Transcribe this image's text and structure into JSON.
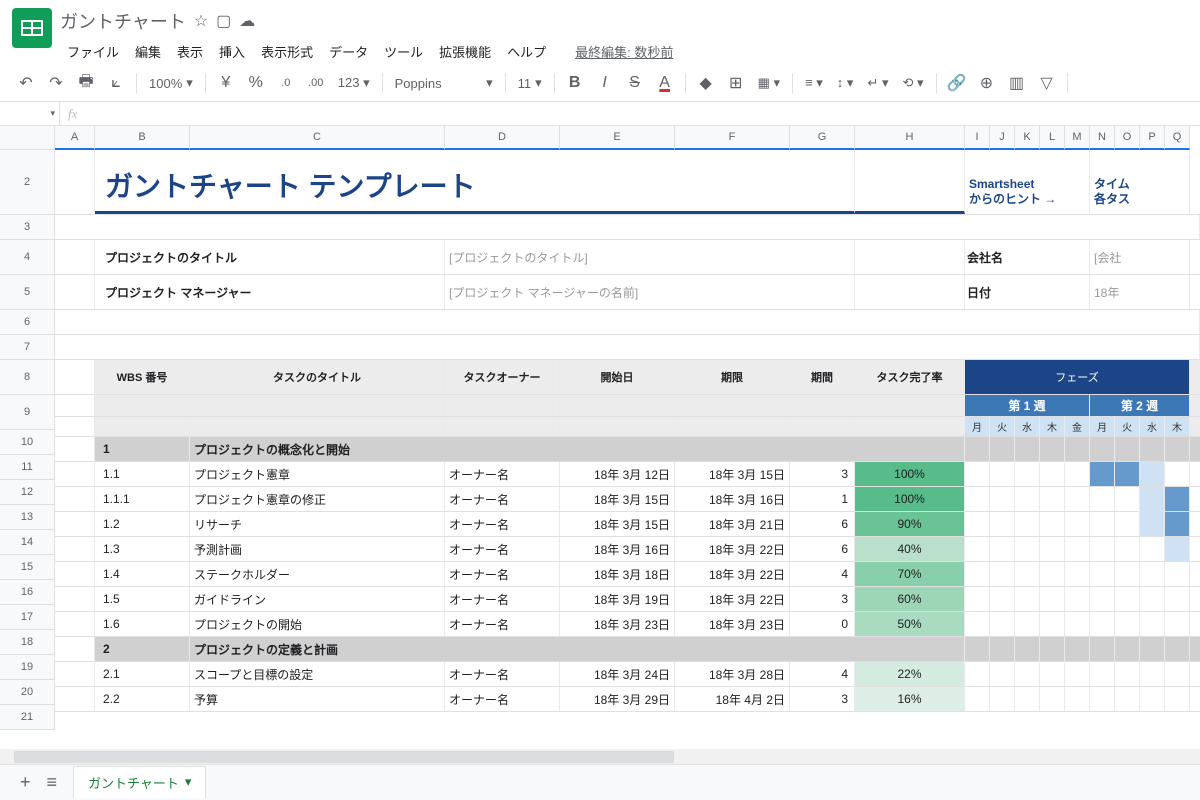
{
  "doc_title": "ガントチャート",
  "last_edit": "最終編集: 数秒前",
  "menu": [
    "ファイル",
    "編集",
    "表示",
    "挿入",
    "表示形式",
    "データ",
    "ツール",
    "拡張機能",
    "ヘルプ"
  ],
  "toolbar": {
    "zoom": "100%",
    "currency": "¥",
    "font": "Poppins",
    "size": "11"
  },
  "namebox": "",
  "cols": {
    "A": 40,
    "B": 95,
    "C": 255,
    "D": 115,
    "E": 115,
    "F": 115,
    "G": 65,
    "H": 110,
    "I": 25,
    "J": 25,
    "K": 25,
    "L": 25,
    "M": 25,
    "N": 25,
    "O": 25,
    "P": 25,
    "Q": 25
  },
  "title": "ガントチャート テンプレート",
  "hint": "Smartsheet\nからのヒント →",
  "cutoff": "タイム\n各タス",
  "labels": {
    "project_title": "プロジェクトのタイトル",
    "pm": "プロジェクト マネージャー",
    "company": "会社名",
    "date": "日付"
  },
  "placeholders": {
    "project_title": "[プロジェクトのタイトル]",
    "pm": "[プロジェクト マネージャーの名前]",
    "company": "[会社",
    "date": "18年"
  },
  "headers": {
    "wbs": "WBS 番号",
    "task": "タスクのタイトル",
    "owner": "タスクオーナー",
    "start": "開始日",
    "end": "期限",
    "dur": "期間",
    "pct": "タスク完了率",
    "phase": "フェーズ",
    "week1": "第 1 週",
    "week2": "第 2 週"
  },
  "days": [
    "月",
    "火",
    "水",
    "木",
    "金",
    "月",
    "火",
    "水",
    "木"
  ],
  "rows": [
    {
      "type": "section",
      "wbs": "1",
      "task": "プロジェクトの概念化と開始"
    },
    {
      "type": "task",
      "wbs": "1.1",
      "task": "プロジェクト憲章",
      "owner": "オーナー名",
      "start": "18年 3月 12日",
      "end": "18年 3月 15日",
      "dur": "3",
      "pct": "100%",
      "pctColor": "#57bb8a",
      "gantt": [
        0,
        0,
        0,
        0,
        0,
        2,
        2,
        1,
        0
      ]
    },
    {
      "type": "task",
      "wbs": "1.1.1",
      "task": "プロジェクト憲章の修正",
      "owner": "オーナー名",
      "start": "18年 3月 15日",
      "end": "18年 3月 16日",
      "dur": "1",
      "pct": "100%",
      "pctColor": "#57bb8a",
      "gantt": [
        0,
        0,
        0,
        0,
        0,
        0,
        0,
        1,
        2
      ]
    },
    {
      "type": "task",
      "wbs": "1.2",
      "task": "リサーチ",
      "owner": "オーナー名",
      "start": "18年 3月 15日",
      "end": "18年 3月 21日",
      "dur": "6",
      "pct": "90%",
      "pctColor": "#6ac395",
      "gantt": [
        0,
        0,
        0,
        0,
        0,
        0,
        0,
        1,
        2
      ]
    },
    {
      "type": "task",
      "wbs": "1.3",
      "task": "予測計画",
      "owner": "オーナー名",
      "start": "18年 3月 16日",
      "end": "18年 3月 22日",
      "dur": "6",
      "pct": "40%",
      "pctColor": "#b8e0cb",
      "gantt": [
        0,
        0,
        0,
        0,
        0,
        0,
        0,
        0,
        1
      ]
    },
    {
      "type": "task",
      "wbs": "1.4",
      "task": "ステークホルダー",
      "owner": "オーナー名",
      "start": "18年 3月 18日",
      "end": "18年 3月 22日",
      "dur": "4",
      "pct": "70%",
      "pctColor": "#8acfab",
      "gantt": [
        0,
        0,
        0,
        0,
        0,
        0,
        0,
        0,
        0
      ]
    },
    {
      "type": "task",
      "wbs": "1.5",
      "task": "ガイドライン",
      "owner": "オーナー名",
      "start": "18年 3月 19日",
      "end": "18年 3月 22日",
      "dur": "3",
      "pct": "60%",
      "pctColor": "#9cd6b6",
      "gantt": [
        0,
        0,
        0,
        0,
        0,
        0,
        0,
        0,
        0
      ]
    },
    {
      "type": "task",
      "wbs": "1.6",
      "task": "プロジェクトの開始",
      "owner": "オーナー名",
      "start": "18年 3月 23日",
      "end": "18年 3月 23日",
      "dur": "0",
      "pct": "50%",
      "pctColor": "#a8dbc0",
      "gantt": [
        0,
        0,
        0,
        0,
        0,
        0,
        0,
        0,
        0
      ]
    },
    {
      "type": "section",
      "wbs": "2",
      "task": "プロジェクトの定義と計画"
    },
    {
      "type": "task",
      "wbs": "2.1",
      "task": "スコープと目標の設定",
      "owner": "オーナー名",
      "start": "18年 3月 24日",
      "end": "18年 3月 28日",
      "dur": "4",
      "pct": "22%",
      "pctColor": "#d4ece0",
      "gantt": [
        0,
        0,
        0,
        0,
        0,
        0,
        0,
        0,
        0
      ]
    },
    {
      "type": "task",
      "wbs": "2.2",
      "task": "予算",
      "owner": "オーナー名",
      "start": "18年 3月 29日",
      "end": "18年 4月 2日",
      "dur": "3",
      "pct": "16%",
      "pctColor": "#dceee5",
      "gantt": [
        0,
        0,
        0,
        0,
        0,
        0,
        0,
        0,
        0
      ]
    }
  ],
  "sheet_tab": "ガントチャート",
  "row_nums_left": [
    "2",
    "3",
    "4",
    "5",
    "6",
    "7",
    "8",
    "9",
    "10",
    "11",
    "12",
    "13",
    "14",
    "15",
    "16",
    "17",
    "18",
    "19",
    "20",
    "21"
  ]
}
